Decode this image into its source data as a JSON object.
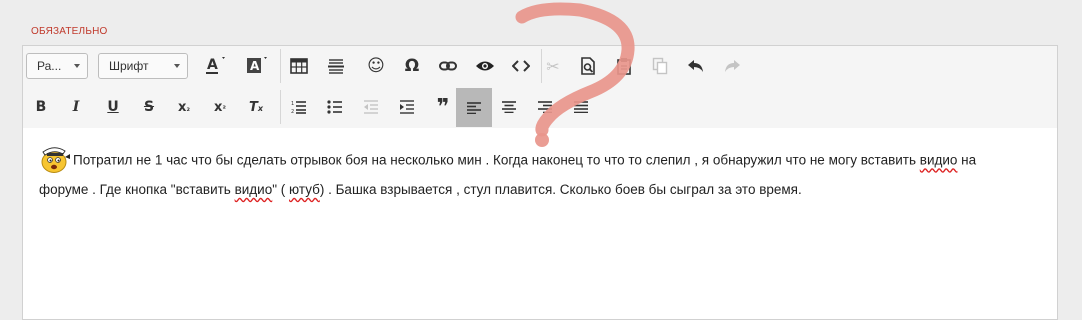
{
  "field": {
    "required_label": "ОБЯЗАТЕЛЬНО"
  },
  "toolbar": {
    "paragraph_format": "Ра...",
    "font": "Шрифт",
    "row1": [
      {
        "name": "text-color-icon",
        "glyph": "A"
      },
      {
        "name": "background-color-icon",
        "glyph": "A"
      },
      {
        "name": "table-icon"
      },
      {
        "name": "horizontal-rule-icon"
      },
      {
        "name": "emoji-icon",
        "glyph": "☺"
      },
      {
        "name": "special-char-icon",
        "glyph": "Ω"
      },
      {
        "name": "link-icon"
      },
      {
        "name": "preview-icon"
      },
      {
        "name": "source-code-icon",
        "glyph": "<>"
      },
      {
        "name": "cut-icon",
        "glyph": "✂"
      },
      {
        "name": "paste-text-icon"
      },
      {
        "name": "paste-icon"
      },
      {
        "name": "copy-icon"
      },
      {
        "name": "undo-icon",
        "glyph": "↶"
      },
      {
        "name": "redo-icon",
        "glyph": "↷"
      }
    ],
    "row2_labels": {
      "bold": "B",
      "italic": "I",
      "underline": "U",
      "strike": "S",
      "subscript": "x",
      "subscript_small": "₂",
      "superscript": "x",
      "superscript_small": "²",
      "remove_format": "T",
      "remove_format_small": "x",
      "blockquote": "❞"
    }
  },
  "content": {
    "line1_part1": "Потратил не 1 час что бы сделать отрывок боя на несколько мин . Когда наконец то что то слепил , я обнаружил что не могу вставить ",
    "line1_misspelled": "видио",
    "line1_part2": " на",
    "line2_part1": "форуме . Где кнопка \"вставить ",
    "line2_misspelled1": "видио",
    "line2_part2": "\"  ( ",
    "line2_misspelled2": "ютуб",
    "line2_part3": ") . Башка взрывается , стул плавится. Сколько боев бы сыграл за это время."
  },
  "colors": {
    "required_label": "#c0392b",
    "question_mark_overlay": "#e8958b",
    "active_button": "#b8b8b8",
    "disabled_icon": "#c4c4c4"
  }
}
